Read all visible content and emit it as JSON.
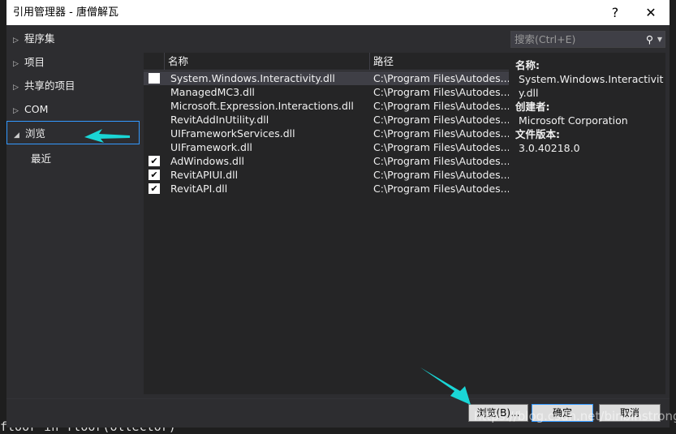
{
  "window": {
    "title": "引用管理器 - 唐僧解瓦",
    "help": "?",
    "close": "✕"
  },
  "tree": [
    {
      "label": "程序集",
      "expanded": false
    },
    {
      "label": "项目",
      "expanded": false
    },
    {
      "label": "共享的项目",
      "expanded": false
    },
    {
      "label": "COM",
      "expanded": false
    },
    {
      "label": "浏览",
      "expanded": true,
      "selected": true
    },
    {
      "label": "最近",
      "child": true
    }
  ],
  "search": {
    "placeholder": "搜索(Ctrl+E)"
  },
  "list": {
    "columns": [
      "名称",
      "路径"
    ],
    "rows": [
      {
        "name": "System.Windows.Interactivity.dll",
        "path": "C:\\Program Files\\Autodes...",
        "checked": false,
        "show_checkbox": true,
        "highlighted": true
      },
      {
        "name": "ManagedMC3.dll",
        "path": "C:\\Program Files\\Autodes...",
        "checked": false
      },
      {
        "name": "Microsoft.Expression.Interactions.dll",
        "path": "C:\\Program Files\\Autodes...",
        "checked": false
      },
      {
        "name": "RevitAddInUtility.dll",
        "path": "C:\\Program Files\\Autodes...",
        "checked": false
      },
      {
        "name": "UIFrameworkServices.dll",
        "path": "C:\\Program Files\\Autodes...",
        "checked": false
      },
      {
        "name": "UIFramework.dll",
        "path": "C:\\Program Files\\Autodes...",
        "checked": false
      },
      {
        "name": "AdWindows.dll",
        "path": "C:\\Program Files\\Autodes...",
        "checked": true
      },
      {
        "name": "RevitAPIUI.dll",
        "path": "C:\\Program Files\\Autodes...",
        "checked": true
      },
      {
        "name": "RevitAPI.dll",
        "path": "C:\\Program Files\\Autodes...",
        "checked": true
      }
    ]
  },
  "detail": {
    "name_label": "名称:",
    "name": "System.Windows.Interactivity.dll",
    "creator_label": "创建者:",
    "creator": "Microsoft Corporation",
    "version_label": "文件版本:",
    "version": "3.0.40218.0"
  },
  "buttons": {
    "browse": "浏览(B)...",
    "ok": "确定",
    "cancel": "取消"
  },
  "watermark": "https://blog.csdn.net/binbinstrong",
  "background_code": "floor in floor(ollector)",
  "colors": {
    "accent": "#3399ff",
    "annotation_arrow": "#1ad6d6"
  }
}
